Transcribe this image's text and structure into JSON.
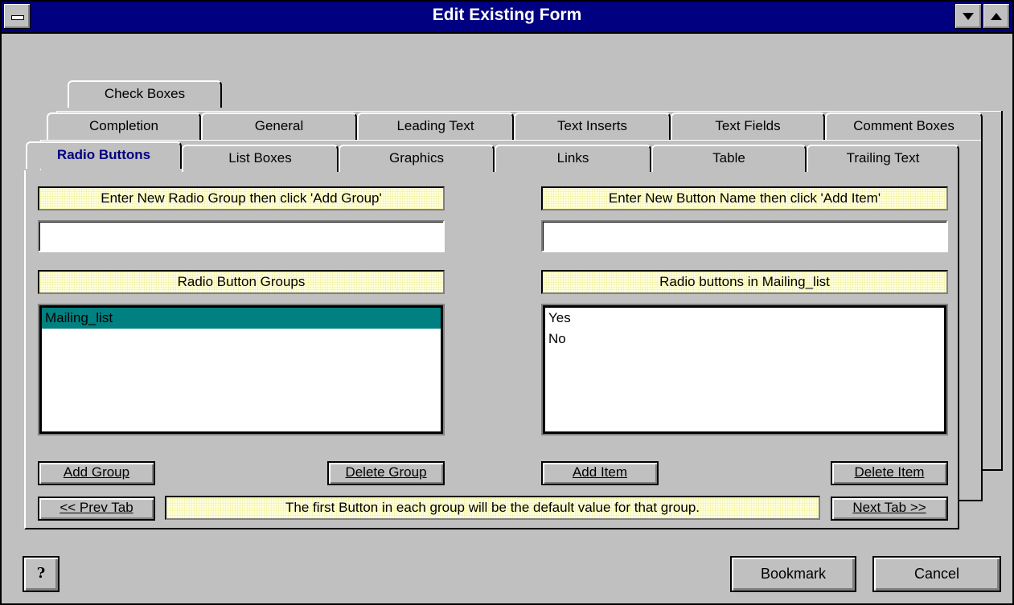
{
  "window": {
    "title": "Edit Existing Form"
  },
  "tabs": {
    "row_back": [
      "Check Boxes"
    ],
    "row_middle": [
      "Completion",
      "General",
      "Leading Text",
      "Text Inserts",
      "Text Fields",
      "Comment Boxes"
    ],
    "row_front": [
      "Radio Buttons",
      "List Boxes",
      "Graphics",
      "Links",
      "Table",
      "Trailing Text"
    ],
    "active": "Radio Buttons"
  },
  "left": {
    "prompt": "Enter New Radio Group then click 'Add Group'",
    "input_value": "",
    "list_header": "Radio Button Groups",
    "items": [
      "Mailing_list"
    ],
    "selected_index": 0
  },
  "right": {
    "prompt": "Enter New Button Name then click 'Add Item'",
    "input_value": "",
    "list_header": "Radio buttons in Mailing_list",
    "items": [
      "Yes",
      "No"
    ]
  },
  "buttons": {
    "add_group": "Add Group",
    "delete_group": "Delete Group",
    "add_item": "Add Item",
    "delete_item": "Delete Item",
    "prev_tab": "<< Prev Tab",
    "next_tab": "Next Tab >>",
    "bookmark": "Bookmark",
    "cancel": "Cancel",
    "help": "?"
  },
  "status_message": "The first Button in each group will be the default value for that group."
}
